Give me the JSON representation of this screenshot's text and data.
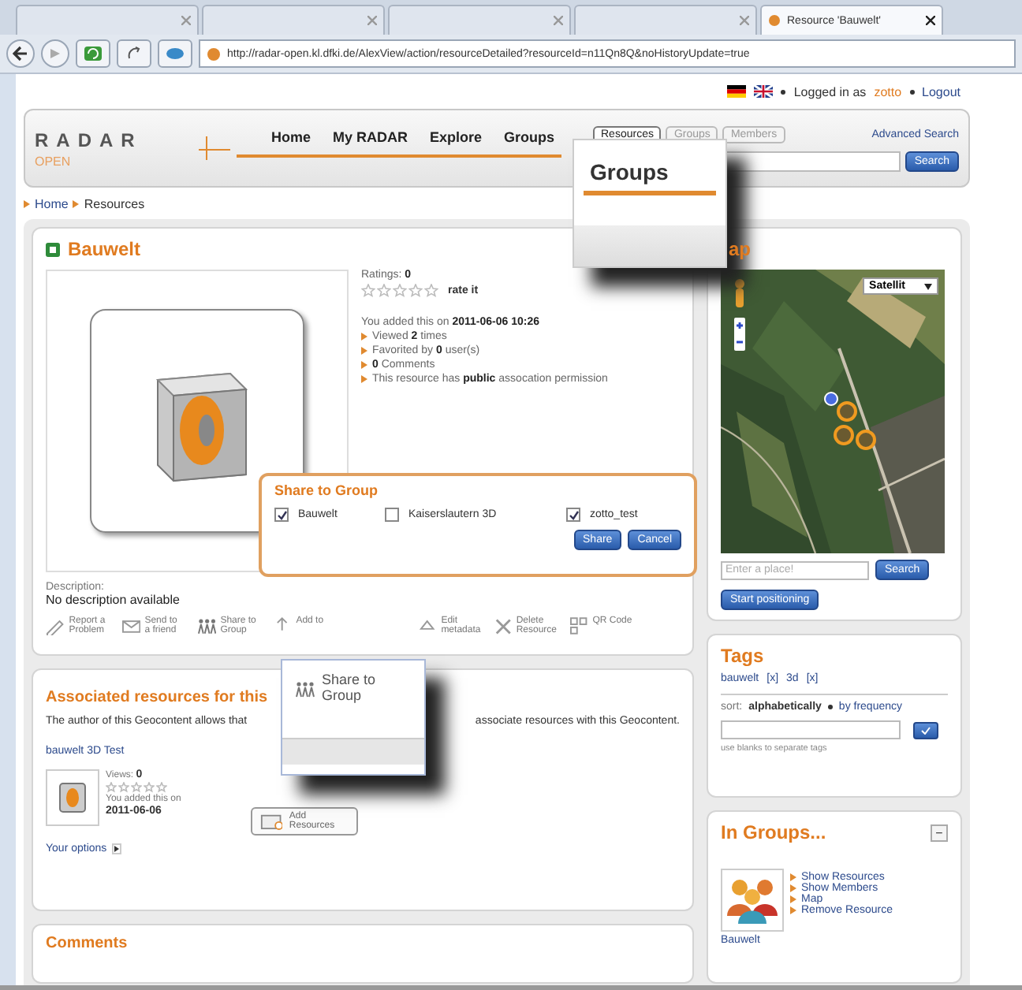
{
  "browser": {
    "tabs": [
      {
        "selected": false
      },
      {
        "selected": false
      },
      {
        "selected": false
      },
      {
        "selected": false
      },
      {
        "title": "Resource 'Bauwelt'",
        "selected": true
      }
    ],
    "url": "http://radar-open.kl.dfki.de/AlexView/action/resourceDetailed?resourceId=n11Qn8Q&noHistoryUpdate=true"
  },
  "account": {
    "logged_in_label": "Logged in as",
    "user": "zotto",
    "logout": "Logout"
  },
  "header": {
    "logo": "RADAR",
    "logo_sub": "OPEN",
    "nav": [
      "Home",
      "My RADAR",
      "Explore",
      "Groups"
    ],
    "search_tabs": [
      {
        "label": "Resources",
        "selected": true
      },
      {
        "label": "Groups",
        "selected": false
      },
      {
        "label": "Members",
        "selected": false
      }
    ],
    "advanced_search": "Advanced Search",
    "search_button": "Search"
  },
  "breadcrumb": [
    "Home",
    "Resources"
  ],
  "resource": {
    "title": "Bauwelt",
    "ratings_label": "Ratings:",
    "ratings": "0",
    "stars": 0,
    "rate_link": "rate it",
    "added": "You added this on **2011-06-06 10:26**",
    "facts": [
      "Viewed **2** times",
      "Favorited by **0** user(s)",
      "**0** Comments",
      "This resource has **public** assocation permission"
    ],
    "description_label": "Description:",
    "description": "No description available",
    "actions": [
      "Report a Problem",
      "Send to a friend",
      "Share to Group",
      "Add to",
      "Edit metadata",
      "Delete Resource",
      "QR Code"
    ]
  },
  "share_dialog": {
    "title": "Share to Group",
    "groups": [
      {
        "label": "Bauwelt",
        "checked": true
      },
      {
        "label": "Kaiserslautern 3D",
        "checked": false
      },
      {
        "label": "zotto_test",
        "checked": true
      }
    ],
    "buttons": [
      "Share",
      "Cancel"
    ]
  },
  "zoom_groups": {
    "label": "Groups"
  },
  "zoom_share": {
    "label": "Share to Group"
  },
  "associated": {
    "title": "Associated resources for this",
    "text_before": "The author of this Geocontent allows that",
    "text_after": "associate resources with this Geocontent.",
    "link": "bauwelt 3D Test",
    "views_label": "Views:",
    "views": "0",
    "stars": 0,
    "added_label": "You added this on",
    "added_date": "2011-06-06",
    "add_button": "Add Resources",
    "options": "Your options"
  },
  "comments": {
    "title": "Comments"
  },
  "map": {
    "title": "ap",
    "map_type": "Satellit",
    "place_placeholder": "Enter a place!",
    "search_button": "Search",
    "positioning_button": "Start positioning"
  },
  "tags": {
    "title": "Tags",
    "items": [
      {
        "label": "bauwelt",
        "remove": "[x]"
      },
      {
        "label": "3d",
        "remove": "[x]"
      }
    ],
    "sort_label": "sort:",
    "sort_options": [
      {
        "label": "alphabetically",
        "selected": true
      },
      {
        "label": "by frequency",
        "selected": false
      }
    ],
    "hint": "use blanks to separate tags"
  },
  "groups_box": {
    "title": "In Groups...",
    "collapse": "−",
    "links": [
      "Show Resources",
      "Show Members",
      "Map",
      "Remove Resource"
    ],
    "group_name": "Bauwelt"
  }
}
